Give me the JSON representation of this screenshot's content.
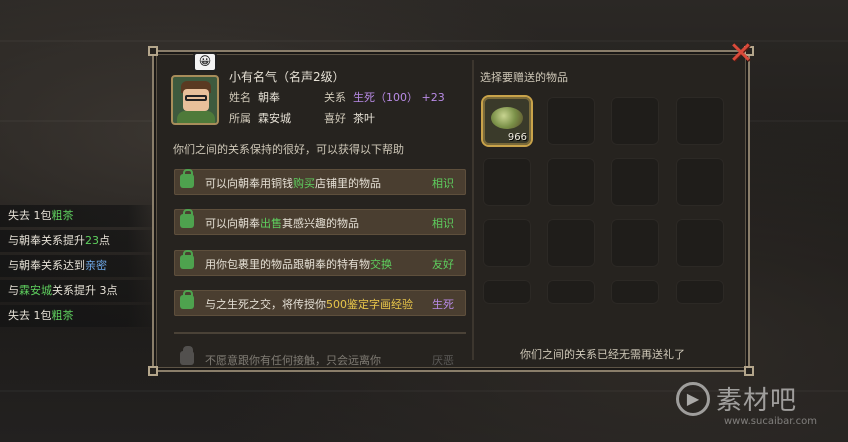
{
  "log": [
    {
      "pre": "失去 1包",
      "hl": "粗茶",
      "post": "",
      "hl_color": "g"
    },
    {
      "pre": "与朝奉关系提升",
      "hl": "23",
      "post": "点",
      "hl_color": "g"
    },
    {
      "pre": "与朝奉关系达到",
      "hl": "亲密",
      "post": "",
      "hl_color": "b"
    },
    {
      "pre": "与",
      "hl": "霖安城",
      "post": "关系提升 3点",
      "hl_color": "g"
    },
    {
      "pre": "失去 1包",
      "hl": "粗茶",
      "post": "",
      "hl_color": "g"
    }
  ],
  "npc": {
    "emote": "😀",
    "fame_line": "小有名气（名声2级）",
    "name_label": "姓名",
    "name": "朝奉",
    "relation_label": "关系",
    "relation": "生死（100）",
    "relation_delta": "+23",
    "faction_label": "所属",
    "faction": "霖安城",
    "likes_label": "喜好",
    "likes": "茶叶"
  },
  "help_text": "你们之间的关系保持的很好，可以获得以下帮助",
  "perks": [
    {
      "pre": "可以向朝奉用铜钱",
      "hl": "购买",
      "post": "店铺里的物品",
      "tier": "相识"
    },
    {
      "pre": "可以向朝奉",
      "hl": "出售",
      "post": "其感兴趣的物品",
      "tier": "相识"
    },
    {
      "pre": "用你包裹里的物品跟朝奉的特有物",
      "hl": "交换",
      "post": "",
      "tier": "友好"
    },
    {
      "pre": "与之生死之交，将传授你",
      "hl": "500鉴定字画经验",
      "post": "",
      "tier": "生死"
    },
    {
      "pre": "不愿意跟你有任何接触，只会远离你",
      "hl": "",
      "post": "",
      "tier": "厌恶"
    }
  ],
  "gift": {
    "title": "选择要赠送的物品",
    "item_count": "966",
    "note": "你们之间的关系已经无需再送礼了"
  },
  "close_glyph": "✕",
  "watermark": {
    "text": "素材吧",
    "url": "www.sucaibar.com"
  }
}
